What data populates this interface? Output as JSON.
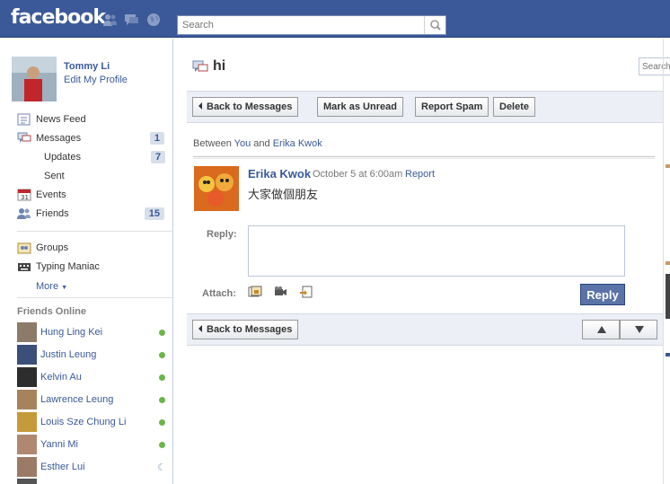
{
  "topbar": {
    "logo": "facebook",
    "search_placeholder": "Search",
    "jewels": [
      "friends-icon",
      "messages-icon",
      "notifications-globe-icon"
    ],
    "bg_color": "#3b5998"
  },
  "profile": {
    "name": "Tommy Li",
    "edit_link": "Edit My Profile"
  },
  "nav": [
    {
      "label": "News Feed",
      "icon": "news-feed-icon",
      "count": ""
    },
    {
      "label": "Messages",
      "icon": "messages-icon",
      "count": "1"
    },
    {
      "label": "Updates",
      "icon": "",
      "count": "7"
    },
    {
      "label": "Sent",
      "icon": "",
      "count": ""
    },
    {
      "label": "Events",
      "icon": "calendar-icon",
      "count": ""
    },
    {
      "label": "Friends",
      "icon": "friends-icon",
      "count": "15"
    }
  ],
  "apps": [
    {
      "label": "Groups",
      "icon": "groups-icon"
    },
    {
      "label": "Typing Maniac",
      "icon": "typing-maniac-icon"
    }
  ],
  "more_label": "More",
  "friends_online": {
    "heading": "Friends Online",
    "people": [
      {
        "name": "Hung Ling Kei",
        "status": "online"
      },
      {
        "name": "Justin Leung",
        "status": "online"
      },
      {
        "name": "Kelvin Au",
        "status": "online"
      },
      {
        "name": "Lawrence Leung",
        "status": "online"
      },
      {
        "name": "Louis Sze Chung Li",
        "status": "online"
      },
      {
        "name": "Yanni Mi",
        "status": "online"
      },
      {
        "name": "Esther Lui",
        "status": "idle"
      }
    ]
  },
  "thread": {
    "title": "hi",
    "search_placeholder": "Search",
    "buttons": {
      "back": "Back to Messages",
      "mark_unread": "Mark as Unread",
      "report_spam": "Report Spam",
      "delete": "Delete"
    },
    "between_prefix": "Between",
    "between_you": "You",
    "between_and": "and",
    "between_other": "Erika Kwok",
    "message": {
      "sender": "Erika Kwok",
      "time": "October 5 at 6:00am",
      "report_link": "Report",
      "body": "大家做個朋友"
    },
    "reply_label": "Reply:",
    "attach_label": "Attach:",
    "attach_icons": [
      "attach-photo-icon",
      "attach-video-icon",
      "attach-link-icon"
    ],
    "reply_button": "Reply",
    "back_bottom": "Back to Messages"
  }
}
